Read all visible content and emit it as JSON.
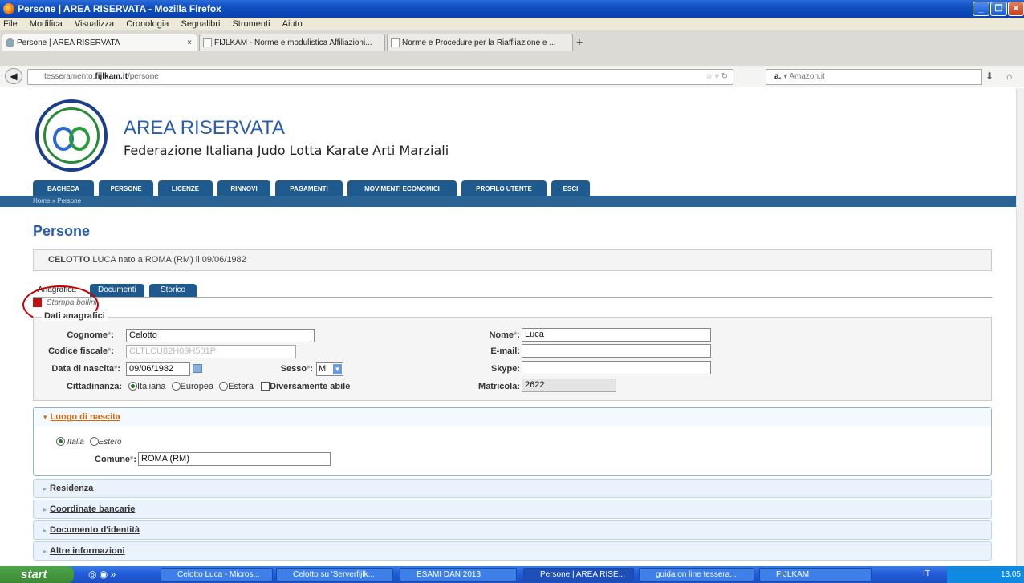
{
  "window": {
    "title": "Persone | AREA RISERVATA - Mozilla Firefox"
  },
  "menu": [
    "File",
    "Modifica",
    "Visualizza",
    "Cronologia",
    "Segnalibri",
    "Strumenti",
    "Aiuto"
  ],
  "browser_tabs": [
    {
      "label": "Persone | AREA RISERVATA"
    },
    {
      "label": "FIJLKAM - Norme e modulistica Affiliazioni..."
    },
    {
      "label": "Norme e Procedure per la Riaffliazione e ..."
    }
  ],
  "url": {
    "host_prefix": "tesseramento.",
    "host_main": "fijlkam.it",
    "path": "/persone"
  },
  "search": {
    "engine": "Amazon.it"
  },
  "site": {
    "title": "AREA RISERVATA",
    "subtitle": "Federazione Italiana Judo Lotta Karate Arti Marziali"
  },
  "nav": [
    "BACHECA",
    "PERSONE",
    "LICENZE",
    "RINNOVI",
    "PAGAMENTI",
    "MOVIMENTI ECONOMICI",
    "PROFILO UTENTE",
    "ESCI"
  ],
  "breadcrumb": "Home » Persone",
  "page_title": "Persone",
  "person": {
    "surname": "CELOTTO",
    "rest": "LUCA nato a ROMA (RM) il 09/06/1982"
  },
  "tabs": [
    "Anagrafica",
    "Documenti",
    "Storico"
  ],
  "stampa": "Stampa bollini",
  "fieldset": {
    "legend": "Dati anagrafici",
    "cognome_label": "Cognome",
    "cognome": "Celotto",
    "cf_label": "Codice fiscale",
    "cf": "CLTLCU82H09H501P",
    "nascita_label": "Data di nascita",
    "nascita": "09/06/1982",
    "sesso_label": "Sesso",
    "sesso": "M",
    "citt_label": "Cittadinanza:",
    "citt_opts": [
      "Italiana",
      "Europea",
      "Estera"
    ],
    "disabile": "Diversamente abile",
    "nome_label": "Nome",
    "nome": "Luca",
    "email_label": "E-mail:",
    "skype_label": "Skype:",
    "matricola_label": "Matricola:",
    "matricola": "2622"
  },
  "luogo": {
    "title": "Luogo di nascita",
    "opt1": "Italia",
    "opt2": "Estero",
    "comune_label": "Comune",
    "comune": "ROMA (RM)"
  },
  "accordions": [
    "Residenza",
    "Coordinate bancarie",
    "Documento d'identità",
    "Altre informazioni"
  ],
  "taskbar": {
    "start": "start",
    "tasks": [
      "Celotto Luca - Micros...",
      "Celotto su 'Serverfijlk...",
      "ESAMI DAN 2013",
      "Persone | AREA RISE...",
      "guida on line tessera...",
      "FIJLKAM"
    ],
    "lang": "IT",
    "clock": "13.05"
  }
}
